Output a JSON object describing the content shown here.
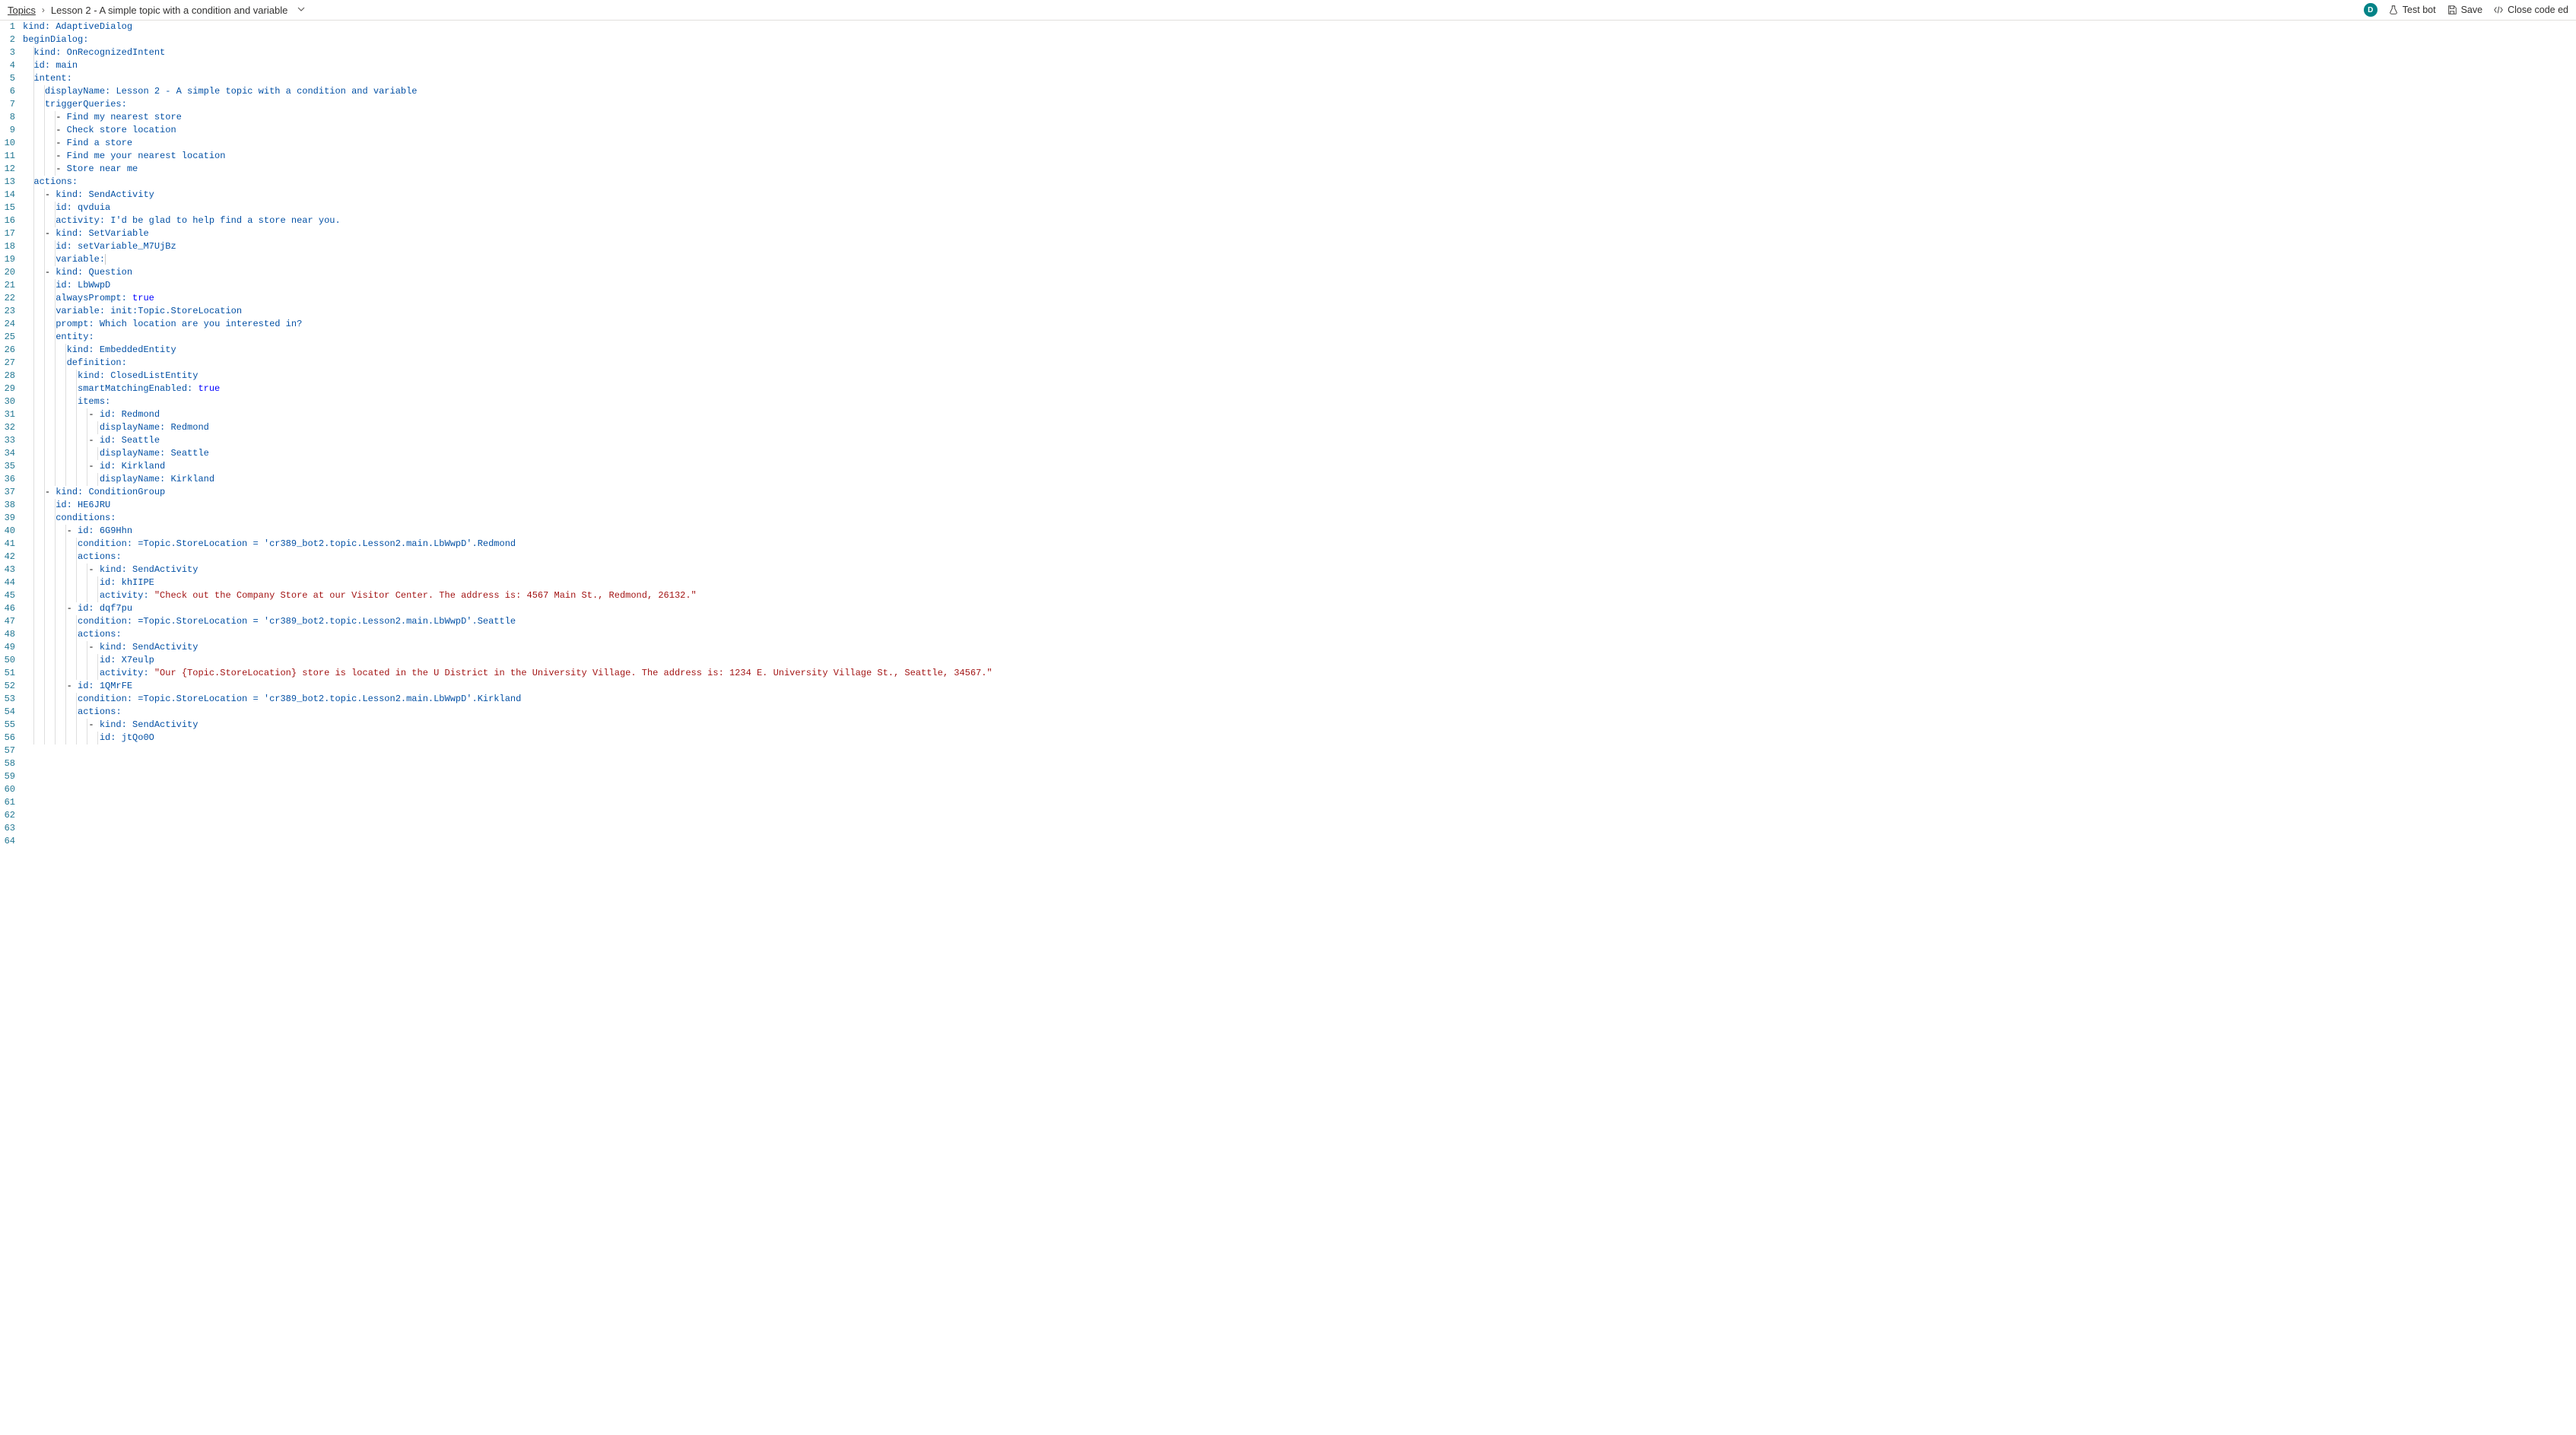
{
  "topbar": {
    "breadcrumb_root": "Topics",
    "breadcrumb_current": "Lesson 2 - A simple topic with a condition and variable",
    "avatar_initial": "D",
    "test_bot": "Test bot",
    "save": "Save",
    "close": "Close code ed"
  },
  "code_lines": [
    [
      [
        "k",
        "kind"
      ],
      [
        "p",
        ": "
      ],
      [
        "v",
        "AdaptiveDialog"
      ]
    ],
    [
      [
        "k",
        "beginDialog"
      ],
      [
        "p",
        ":"
      ]
    ],
    [
      [
        "i",
        1
      ],
      [
        "k",
        "kind"
      ],
      [
        "p",
        ": "
      ],
      [
        "v",
        "OnRecognizedIntent"
      ]
    ],
    [
      [
        "i",
        1
      ],
      [
        "k",
        "id"
      ],
      [
        "p",
        ": "
      ],
      [
        "v",
        "main"
      ]
    ],
    [
      [
        "i",
        1
      ],
      [
        "k",
        "intent"
      ],
      [
        "p",
        ":"
      ]
    ],
    [
      [
        "i",
        2
      ],
      [
        "k",
        "displayName"
      ],
      [
        "p",
        ": "
      ],
      [
        "v",
        "Lesson 2 - A simple topic with a condition and variable"
      ]
    ],
    [
      [
        "i",
        2
      ],
      [
        "k",
        "triggerQueries"
      ],
      [
        "p",
        ":"
      ]
    ],
    [
      [
        "i",
        3
      ],
      [
        "d",
        "- "
      ],
      [
        "v",
        "Find my nearest store"
      ]
    ],
    [
      [
        "i",
        3
      ],
      [
        "d",
        "- "
      ],
      [
        "v",
        "Check store location"
      ]
    ],
    [
      [
        "i",
        3
      ],
      [
        "d",
        "- "
      ],
      [
        "v",
        "Find a store"
      ]
    ],
    [
      [
        "i",
        3
      ],
      [
        "d",
        "- "
      ],
      [
        "v",
        "Find me your nearest location"
      ]
    ],
    [
      [
        "i",
        3
      ],
      [
        "d",
        "- "
      ],
      [
        "v",
        "Store near me"
      ]
    ],
    [],
    [
      [
        "i",
        1
      ],
      [
        "k",
        "actions"
      ],
      [
        "p",
        ":"
      ]
    ],
    [
      [
        "i",
        2
      ],
      [
        "d",
        "- "
      ],
      [
        "k",
        "kind"
      ],
      [
        "p",
        ": "
      ],
      [
        "v",
        "SendActivity"
      ]
    ],
    [
      [
        "i",
        3
      ],
      [
        "k",
        "id"
      ],
      [
        "p",
        ": "
      ],
      [
        "v",
        "qvduia"
      ]
    ],
    [
      [
        "i",
        3
      ],
      [
        "k",
        "activity"
      ],
      [
        "p",
        ": "
      ],
      [
        "v",
        "I'd be glad to help find a store near you."
      ]
    ],
    [],
    [
      [
        "i",
        2
      ],
      [
        "d",
        "- "
      ],
      [
        "k",
        "kind"
      ],
      [
        "p",
        ": "
      ],
      [
        "v",
        "SetVariable"
      ]
    ],
    [
      [
        "i",
        3
      ],
      [
        "k",
        "id"
      ],
      [
        "p",
        ": "
      ],
      [
        "v",
        "setVariable_M7UjBz"
      ]
    ],
    [
      [
        "i",
        3
      ],
      [
        "k",
        "variable"
      ],
      [
        "p",
        ":"
      ],
      [
        "c",
        ""
      ]
    ],
    [],
    [
      [
        "i",
        2
      ],
      [
        "d",
        "- "
      ],
      [
        "k",
        "kind"
      ],
      [
        "p",
        ": "
      ],
      [
        "v",
        "Question"
      ]
    ],
    [
      [
        "i",
        3
      ],
      [
        "k",
        "id"
      ],
      [
        "p",
        ": "
      ],
      [
        "v",
        "LbWwpD"
      ]
    ],
    [
      [
        "i",
        3
      ],
      [
        "k",
        "alwaysPrompt"
      ],
      [
        "p",
        ": "
      ],
      [
        "b",
        "true"
      ]
    ],
    [
      [
        "i",
        3
      ],
      [
        "k",
        "variable"
      ],
      [
        "p",
        ": "
      ],
      [
        "v",
        "init:Topic.StoreLocation"
      ]
    ],
    [
      [
        "i",
        3
      ],
      [
        "k",
        "prompt"
      ],
      [
        "p",
        ": "
      ],
      [
        "v",
        "Which location are you interested in?"
      ]
    ],
    [
      [
        "i",
        3
      ],
      [
        "k",
        "entity"
      ],
      [
        "p",
        ":"
      ]
    ],
    [
      [
        "i",
        4
      ],
      [
        "k",
        "kind"
      ],
      [
        "p",
        ": "
      ],
      [
        "v",
        "EmbeddedEntity"
      ]
    ],
    [
      [
        "i",
        4
      ],
      [
        "k",
        "definition"
      ],
      [
        "p",
        ":"
      ]
    ],
    [
      [
        "i",
        5
      ],
      [
        "k",
        "kind"
      ],
      [
        "p",
        ": "
      ],
      [
        "v",
        "ClosedListEntity"
      ]
    ],
    [
      [
        "i",
        5
      ],
      [
        "k",
        "smartMatchingEnabled"
      ],
      [
        "p",
        ": "
      ],
      [
        "b",
        "true"
      ]
    ],
    [
      [
        "i",
        5
      ],
      [
        "k",
        "items"
      ],
      [
        "p",
        ":"
      ]
    ],
    [
      [
        "i",
        6
      ],
      [
        "d",
        "- "
      ],
      [
        "k",
        "id"
      ],
      [
        "p",
        ": "
      ],
      [
        "v",
        "Redmond"
      ]
    ],
    [
      [
        "i",
        7
      ],
      [
        "k",
        "displayName"
      ],
      [
        "p",
        ": "
      ],
      [
        "v",
        "Redmond"
      ]
    ],
    [],
    [
      [
        "i",
        6
      ],
      [
        "d",
        "- "
      ],
      [
        "k",
        "id"
      ],
      [
        "p",
        ": "
      ],
      [
        "v",
        "Seattle"
      ]
    ],
    [
      [
        "i",
        7
      ],
      [
        "k",
        "displayName"
      ],
      [
        "p",
        ": "
      ],
      [
        "v",
        "Seattle"
      ]
    ],
    [],
    [
      [
        "i",
        6
      ],
      [
        "d",
        "- "
      ],
      [
        "k",
        "id"
      ],
      [
        "p",
        ": "
      ],
      [
        "v",
        "Kirkland"
      ]
    ],
    [
      [
        "i",
        7
      ],
      [
        "k",
        "displayName"
      ],
      [
        "p",
        ": "
      ],
      [
        "v",
        "Kirkland"
      ]
    ],
    [],
    [
      [
        "i",
        2
      ],
      [
        "d",
        "- "
      ],
      [
        "k",
        "kind"
      ],
      [
        "p",
        ": "
      ],
      [
        "v",
        "ConditionGroup"
      ]
    ],
    [
      [
        "i",
        3
      ],
      [
        "k",
        "id"
      ],
      [
        "p",
        ": "
      ],
      [
        "v",
        "HE6JRU"
      ]
    ],
    [
      [
        "i",
        3
      ],
      [
        "k",
        "conditions"
      ],
      [
        "p",
        ":"
      ]
    ],
    [
      [
        "i",
        4
      ],
      [
        "d",
        "- "
      ],
      [
        "k",
        "id"
      ],
      [
        "p",
        ": "
      ],
      [
        "v",
        "6G9Hhn"
      ]
    ],
    [
      [
        "i",
        5
      ],
      [
        "k",
        "condition"
      ],
      [
        "p",
        ": "
      ],
      [
        "v",
        "=Topic.StoreLocation = 'cr389_bot2.topic.Lesson2.main.LbWwpD'.Redmond"
      ]
    ],
    [
      [
        "i",
        5
      ],
      [
        "k",
        "actions"
      ],
      [
        "p",
        ":"
      ]
    ],
    [
      [
        "i",
        6
      ],
      [
        "d",
        "- "
      ],
      [
        "k",
        "kind"
      ],
      [
        "p",
        ": "
      ],
      [
        "v",
        "SendActivity"
      ]
    ],
    [
      [
        "i",
        7
      ],
      [
        "k",
        "id"
      ],
      [
        "p",
        ": "
      ],
      [
        "v",
        "khIIPE"
      ]
    ],
    [
      [
        "i",
        7
      ],
      [
        "k",
        "activity"
      ],
      [
        "p",
        ": "
      ],
      [
        "s",
        "\"Check out the Company Store at our Visitor Center. The address is: 4567 Main St., Redmond, 26132.\""
      ]
    ],
    [],
    [
      [
        "i",
        4
      ],
      [
        "d",
        "- "
      ],
      [
        "k",
        "id"
      ],
      [
        "p",
        ": "
      ],
      [
        "v",
        "dqf7pu"
      ]
    ],
    [
      [
        "i",
        5
      ],
      [
        "k",
        "condition"
      ],
      [
        "p",
        ": "
      ],
      [
        "v",
        "=Topic.StoreLocation = 'cr389_bot2.topic.Lesson2.main.LbWwpD'.Seattle"
      ]
    ],
    [
      [
        "i",
        5
      ],
      [
        "k",
        "actions"
      ],
      [
        "p",
        ":"
      ]
    ],
    [
      [
        "i",
        6
      ],
      [
        "d",
        "- "
      ],
      [
        "k",
        "kind"
      ],
      [
        "p",
        ": "
      ],
      [
        "v",
        "SendActivity"
      ]
    ],
    [
      [
        "i",
        7
      ],
      [
        "k",
        "id"
      ],
      [
        "p",
        ": "
      ],
      [
        "v",
        "X7eulp"
      ]
    ],
    [
      [
        "i",
        7
      ],
      [
        "k",
        "activity"
      ],
      [
        "p",
        ": "
      ],
      [
        "s",
        "\"Our {Topic.StoreLocation} store is located in the U District in the University Village. The address is: 1234 E. University Village St., Seattle, 34567.\""
      ]
    ],
    [],
    [
      [
        "i",
        4
      ],
      [
        "d",
        "- "
      ],
      [
        "k",
        "id"
      ],
      [
        "p",
        ": "
      ],
      [
        "v",
        "1QMrFE"
      ]
    ],
    [
      [
        "i",
        5
      ],
      [
        "k",
        "condition"
      ],
      [
        "p",
        ": "
      ],
      [
        "v",
        "=Topic.StoreLocation = 'cr389_bot2.topic.Lesson2.main.LbWwpD'.Kirkland"
      ]
    ],
    [
      [
        "i",
        5
      ],
      [
        "k",
        "actions"
      ],
      [
        "p",
        ":"
      ]
    ],
    [
      [
        "i",
        6
      ],
      [
        "d",
        "- "
      ],
      [
        "k",
        "kind"
      ],
      [
        "p",
        ": "
      ],
      [
        "v",
        "SendActivity"
      ]
    ],
    [
      [
        "i",
        7
      ],
      [
        "k",
        "id"
      ],
      [
        "p",
        ": "
      ],
      [
        "v",
        "jtQo0O"
      ]
    ]
  ]
}
